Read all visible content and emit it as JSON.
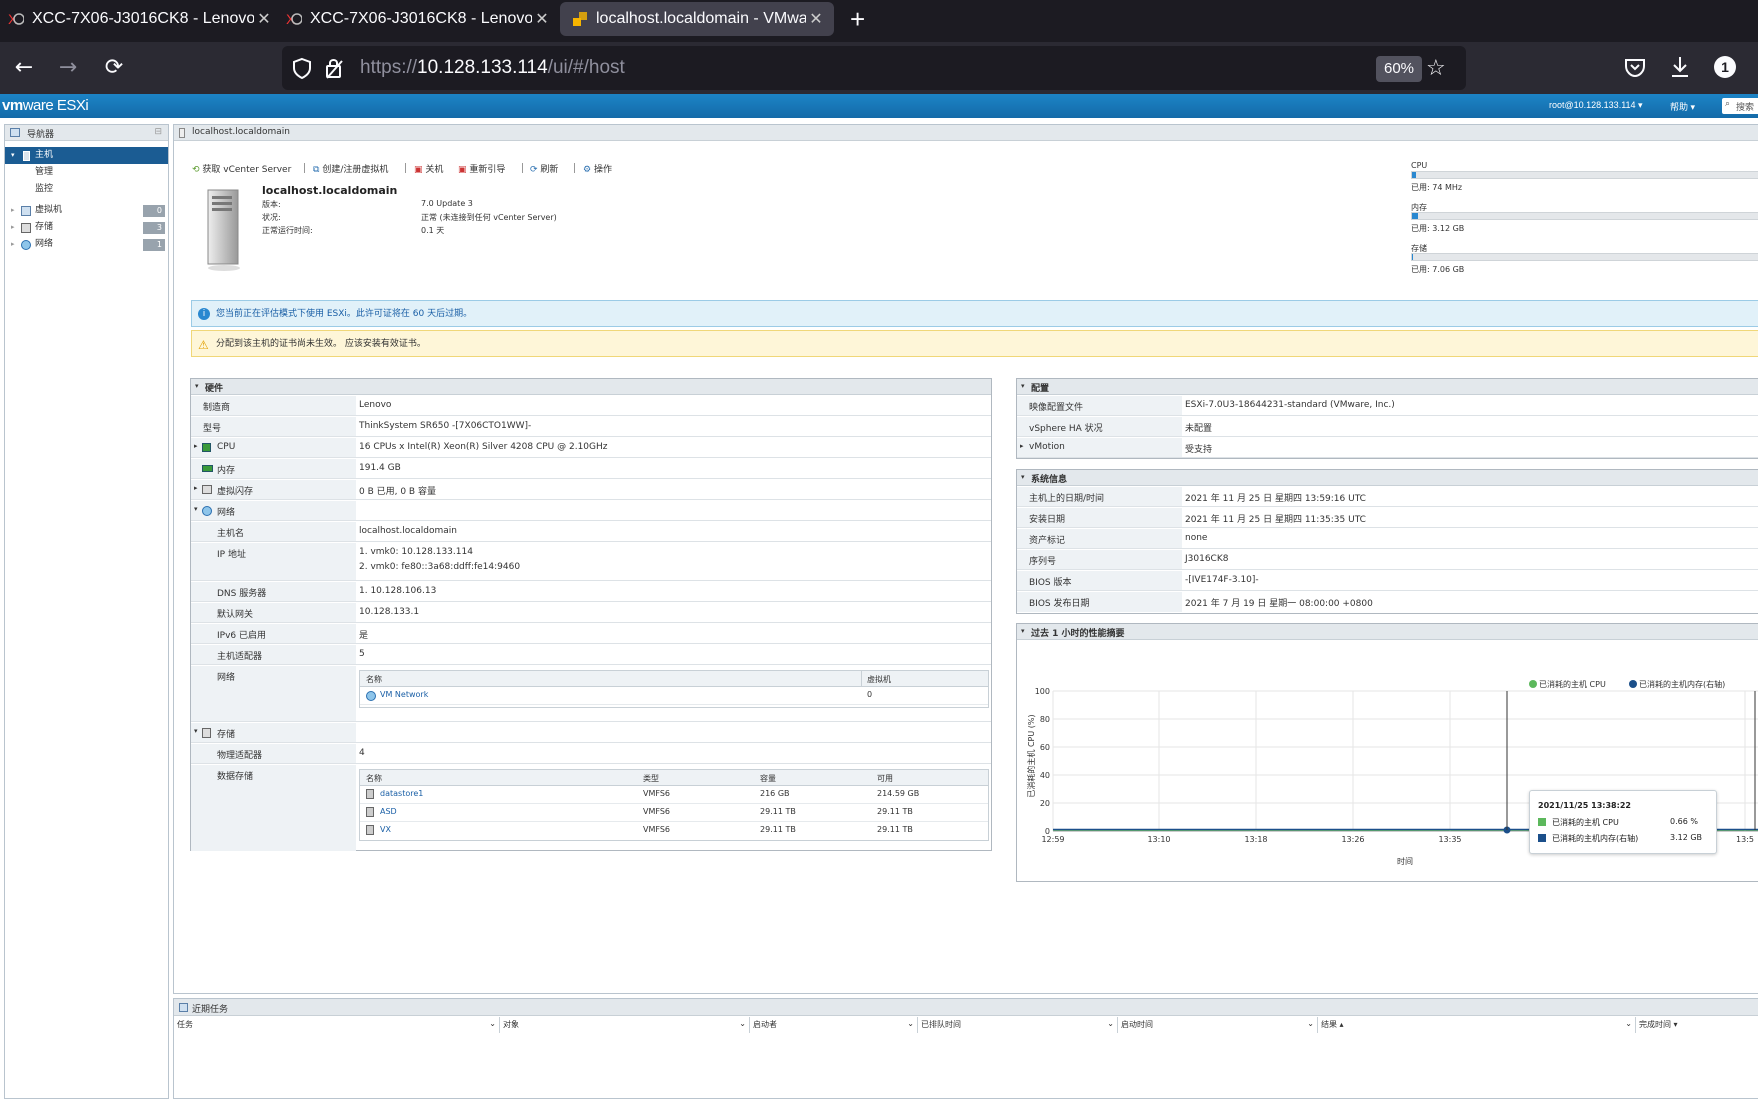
{
  "browser": {
    "tabs": [
      {
        "title": "XCC-7X06-J3016CK8 - Lenovo",
        "close": "✕"
      },
      {
        "title": "XCC-7X06-J3016CK8 - Lenovo",
        "close": "✕"
      },
      {
        "title": "localhost.localdomain - VMware ESXi",
        "close": "✕"
      }
    ],
    "new_tab": "+",
    "url_prefix": "https://",
    "url_host": "10.128.133.114",
    "url_path": "/ui/#/host",
    "zoom": "60%",
    "account_badge": "1"
  },
  "esxi": {
    "logo_vm": "vm",
    "logo_ware": "ware",
    "logo_product": "ESXi",
    "user": "root@10.128.133.114 ▾",
    "help": "帮助 ▾",
    "search": "搜索"
  },
  "nav": {
    "title": "导航器",
    "host": "主机",
    "manage": "管理",
    "monitor": "监控",
    "vms": "虚拟机",
    "vms_count": "0",
    "storage": "存储",
    "storage_count": "3",
    "network": "网络",
    "network_count": "1"
  },
  "main": {
    "title": "localhost.localdomain",
    "toolbar": {
      "vcenter": "获取 vCenter Server",
      "create_vm": "创建/注册虚拟机",
      "shutdown": "关机",
      "reboot": "重新引导",
      "refresh": "刷新",
      "actions": "操作"
    },
    "host_name": "localhost.localdomain",
    "summary": [
      {
        "k": "版本:",
        "v": "7.0 Update 3"
      },
      {
        "k": "状况:",
        "v": "正常 (未连接到任何 vCenter Server)"
      },
      {
        "k": "正常运行时间:",
        "v": "0.1 天"
      }
    ],
    "resources": {
      "cpu_label": "CPU",
      "cpu_used": "已用: 74 MHz",
      "cpu_fraction": 0.01,
      "mem_label": "内存",
      "mem_used": "已用: 3.12 GB",
      "mem_fraction": 0.016,
      "storage_label": "存储",
      "storage_used": "已用: 7.06 GB",
      "storage_fraction": 0.001
    },
    "alert_info": "您当前正在评估模式下使用 ESXi。此许可证将在 60 天后过期。",
    "alert_warn": "分配到该主机的证书尚未生效。 应该安装有效证书。"
  },
  "hardware": {
    "title": "硬件",
    "rows": [
      {
        "k": "制造商",
        "v": "Lenovo"
      },
      {
        "k": "型号",
        "v": "ThinkSystem SR650 -[7X06CTO1WW]-"
      },
      {
        "k": "CPU",
        "v": "16 CPUs x Intel(R) Xeon(R) Silver 4208 CPU @ 2.10GHz"
      },
      {
        "k": "内存",
        "v": "191.4 GB"
      },
      {
        "k": "虚拟闪存",
        "v": "0 B 已用, 0 B 容量"
      },
      {
        "k": "网络",
        "v": ""
      },
      {
        "k": "主机名",
        "v": "localhost.localdomain"
      },
      {
        "k": "IP 地址",
        "v": "1. vmk0: 10.128.133.114"
      },
      {
        "k": "DNS 服务器",
        "v": "1. 10.128.106.13"
      },
      {
        "k": "默认网关",
        "v": "10.128.133.1"
      },
      {
        "k": "IPv6 已启用",
        "v": "是"
      },
      {
        "k": "主机适配器",
        "v": "5"
      },
      {
        "k": "网络",
        "v": ""
      },
      {
        "k": "存储",
        "v": ""
      },
      {
        "k": "物理适配器",
        "v": "4"
      },
      {
        "k": "数据存储",
        "v": ""
      }
    ],
    "ip2": "2. vmk0: fe80::3a68:ddff:fe14:9460",
    "net_table": {
      "headers": [
        "名称",
        "虚拟机"
      ],
      "rows": [
        [
          "VM Network",
          "0"
        ]
      ]
    },
    "ds_table": {
      "headers": [
        "名称",
        "类型",
        "容量",
        "可用"
      ],
      "rows": [
        [
          "datastore1",
          "VMFS6",
          "216 GB",
          "214.59 GB"
        ],
        [
          "ASD",
          "VMFS6",
          "29.11 TB",
          "29.11 TB"
        ],
        [
          "VX",
          "VMFS6",
          "29.11 TB",
          "29.11 TB"
        ]
      ]
    }
  },
  "config": {
    "title": "配置",
    "rows": [
      {
        "k": "映像配置文件",
        "v": "ESXi-7.0U3-18644231-standard (VMware, Inc.)"
      },
      {
        "k": "vSphere HA 状况",
        "v": "未配置"
      },
      {
        "k": "vMotion",
        "v": "受支持"
      }
    ]
  },
  "sysinfo": {
    "title": "系统信息",
    "rows": [
      {
        "k": "主机上的日期/时间",
        "v": "2021 年 11 月 25 日 星期四 13:59:16 UTC"
      },
      {
        "k": "安装日期",
        "v": "2021 年 11 月 25 日 星期四 11:35:35 UTC"
      },
      {
        "k": "资产标记",
        "v": "none"
      },
      {
        "k": "序列号",
        "v": "J3016CK8"
      },
      {
        "k": "BIOS 版本",
        "v": "-[IVE174F-3.10]-"
      },
      {
        "k": "BIOS 发布日期",
        "v": "2021 年 7 月 19 日 星期一 08:00:00 +0800"
      }
    ]
  },
  "perf": {
    "title": "过去 1 小时的性能摘要",
    "legend_cpu": "已消耗的主机 CPU",
    "legend_mem": "已消耗的主机内存(右轴)",
    "tooltip_time": "2021/11/25 13:38:22",
    "tooltip_cpu_label": "已消耗的主机 CPU",
    "tooltip_cpu_value": "0.66 %",
    "tooltip_mem_label": "已消耗的主机内存(右轴)",
    "tooltip_mem_value": "3.12 GB"
  },
  "chart_data": {
    "type": "line",
    "xlabel": "时间",
    "ylabel": "已消耗的主机 CPU (%)",
    "ylim": [
      0,
      100
    ],
    "yticks": [
      0,
      20,
      40,
      60,
      80,
      100
    ],
    "xticks": [
      "12:59",
      "13:10",
      "13:18",
      "13:26",
      "13:35",
      "13:5"
    ],
    "series": [
      {
        "name": "已消耗的主机 CPU",
        "color": "#5cb85c",
        "x": [
          "12:59",
          "13:10",
          "13:18",
          "13:26",
          "13:35",
          "13:38",
          "13:45",
          "13:55"
        ],
        "values": [
          0.7,
          0.6,
          0.7,
          0.6,
          0.7,
          0.66,
          0.6,
          0.7
        ]
      },
      {
        "name": "已消耗的主机内存(右轴)",
        "color": "#1b4f8a",
        "x": [
          "12:59",
          "13:10",
          "13:18",
          "13:26",
          "13:35",
          "13:38",
          "13:45",
          "13:55"
        ],
        "values": [
          3.12,
          3.12,
          3.12,
          3.12,
          3.12,
          3.12,
          3.12,
          3.12
        ]
      }
    ],
    "grid": true,
    "legend": "top-right"
  },
  "tasks": {
    "title": "近期任务",
    "headers": [
      "任务",
      "对象",
      "启动者",
      "已排队时间",
      "启动时间",
      "结果 ▴",
      "完成时间 ▾"
    ]
  },
  "colors": {
    "accent": "#1b5c93",
    "header": "#1c84c6",
    "info_bg": "#e1f1f9",
    "warn_bg": "#fef6d8"
  }
}
